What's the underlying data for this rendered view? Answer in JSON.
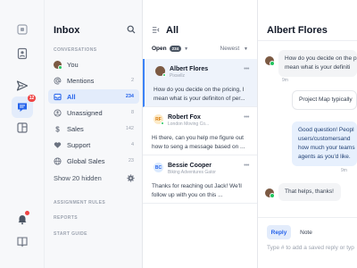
{
  "rail": {
    "inbox_badge": "12",
    "icons": [
      "logo-icon",
      "contacts-icon",
      "send-icon",
      "inbox-icon",
      "reports-icon",
      "bell-icon",
      "book-icon"
    ]
  },
  "sidebar": {
    "title": "Inbox",
    "conversations_heading": "CONVERSATIONS",
    "items": [
      {
        "label": "You",
        "count": "",
        "icon": "avatar"
      },
      {
        "label": "Mentions",
        "count": "2",
        "icon": "at-icon"
      },
      {
        "label": "All",
        "count": "234",
        "icon": "inbox-icon"
      },
      {
        "label": "Unassigned",
        "count": "8",
        "icon": "user-icon"
      },
      {
        "label": "Sales",
        "count": "142",
        "icon": "dollar-icon"
      },
      {
        "label": "Support",
        "count": "4",
        "icon": "heart-icon"
      },
      {
        "label": "Global Sales",
        "count": "23",
        "icon": "globe-icon"
      }
    ],
    "show_hidden": "Show 20 hidden",
    "assignment_rules": "ASSIGNMENT RULES",
    "reports": "REPORTS",
    "start_guide": "START GUIDE"
  },
  "list": {
    "title": "All",
    "filter_label": "Open",
    "filter_count": "234",
    "sort_label": "Newest",
    "conversations": [
      {
        "name": "Albert Flores",
        "company": "Pixsellz",
        "initials": "",
        "preview": "How do you decide on the pricing, I mean what is your definiton of per...",
        "active": true
      },
      {
        "name": "Robert Fox",
        "company": "London Moving Co...",
        "initials": "RF",
        "preview": "Hi there, can you help me figure out how to seng a message based on ...",
        "active": false
      },
      {
        "name": "Bessie Cooper",
        "company": "Biking Adventures Gator",
        "initials": "BC",
        "preview": "Thanks for reaching out Jack! We'll follow up with you on this ...",
        "active": false
      }
    ]
  },
  "chat": {
    "title": "Albert Flores",
    "messages": [
      {
        "type": "in",
        "lines": [
          "How do you decide on the pr",
          "mean what is your definiti"
        ]
      },
      {
        "type": "note",
        "lines": [
          "Project Map typically"
        ]
      },
      {
        "type": "out",
        "lines": [
          "Good question! Peopl",
          "users/customersand",
          "how much your teams",
          "agents as you'd like."
        ]
      },
      {
        "type": "in",
        "lines": [
          "That helps, thanks!"
        ]
      }
    ],
    "timestamps": [
      "9m",
      "9m"
    ],
    "reply_tab": "Reply",
    "note_tab": "Note",
    "composer_placeholder": "Type # to add a saved reply or type"
  },
  "colors": {
    "accent": "#2563eb",
    "active_bg": "#e3ecfb",
    "online": "#22c55e",
    "badge": "#ef4444"
  }
}
